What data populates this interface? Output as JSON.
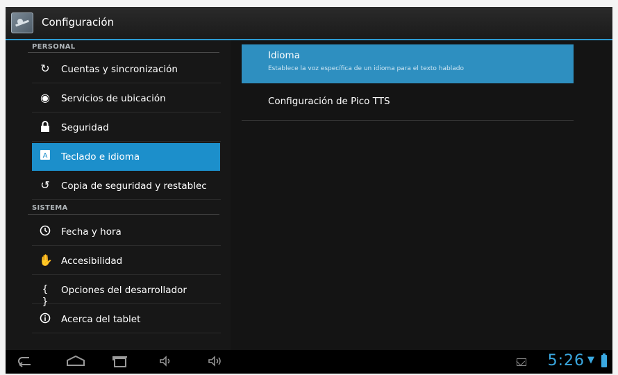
{
  "header": {
    "title": "Configuración"
  },
  "sidebar": {
    "sections": [
      {
        "label": "PERSONAL"
      },
      {
        "label": "SISTEMA"
      }
    ],
    "items": [
      {
        "label": "Cuentas y sincronización",
        "icon": "sync-icon"
      },
      {
        "label": "Servicios de ubicación",
        "icon": "location-icon"
      },
      {
        "label": "Seguridad",
        "icon": "lock-icon"
      },
      {
        "label": "Teclado e idioma",
        "icon": "keyboard-icon",
        "selected": true
      },
      {
        "label": "Copia de seguridad y restablec",
        "icon": "backup-icon"
      },
      {
        "label": "Fecha y hora",
        "icon": "clock-icon"
      },
      {
        "label": "Accesibilidad",
        "icon": "hand-icon"
      },
      {
        "label": "Opciones del desarrollador",
        "icon": "braces-icon"
      },
      {
        "label": "Acerca del tablet",
        "icon": "info-icon"
      }
    ]
  },
  "main": {
    "items": [
      {
        "title": "Idioma",
        "subtitle": "Establece la voz específica de un idioma para el texto hablado"
      },
      {
        "title": "Configuración de Pico TTS"
      }
    ]
  },
  "statusbar": {
    "time": "5:26"
  },
  "colors": {
    "accent": "#1c8fcb",
    "time": "#3aa8e0"
  }
}
